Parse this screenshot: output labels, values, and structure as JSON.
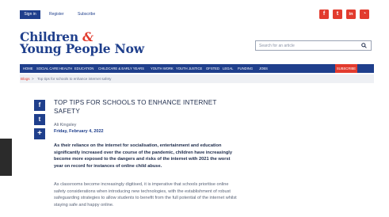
{
  "header": {
    "signin_label": "Sign in",
    "register_label": "Register",
    "subscribe_label": "Subscribe",
    "social": [
      {
        "icon": "facebook-icon",
        "glyph": "f"
      },
      {
        "icon": "twitter-icon",
        "glyph": "t"
      },
      {
        "icon": "linkedin-icon",
        "glyph": "in"
      },
      {
        "icon": "rss-icon",
        "glyph": "◔"
      }
    ],
    "social_color": "#e23b2e"
  },
  "logo": {
    "line1": "Children",
    "amp": "&",
    "line2": "Young People Now"
  },
  "search": {
    "placeholder": "Search for an article"
  },
  "nav": {
    "items": [
      "HOME",
      "SOCIAL CARE",
      "HEALTH",
      "EDUCATION",
      "CHILDCARE & EARLY YEARS",
      "YOUTH WORK",
      "YOUTH JUSTICE",
      "OFSTED",
      "LEGAL",
      "FUNDING",
      "JOBS"
    ],
    "subscribe_label": "SUBSCRIBE",
    "brand_color": "#1f3f8c",
    "accent_color": "#e23b2e"
  },
  "breadcrumb": {
    "blogs": "Blogs",
    "separator": ">",
    "current": "Top tips for schools to enhance internet safety"
  },
  "share": [
    {
      "icon": "facebook-icon",
      "glyph": "f"
    },
    {
      "icon": "twitter-icon",
      "glyph": "t"
    },
    {
      "icon": "plus-icon",
      "glyph": "+"
    }
  ],
  "article": {
    "title_line1": "TOP TIPS FOR SCHOOLS TO ENHANCE INTERNET",
    "title_line2": "SAFETY",
    "author": "Ali Kingsley",
    "date": "Friday, February 4, 2022",
    "lead": "As their reliance on the internet for socialisation, entertainment and education significantly increased over the course of the pandemic, children have increasingly become more exposed to the dangers and risks of the internet with 2021 the worst year on record for instances of online child abuse.",
    "paragraph": "As classrooms become increasingly digitised, it is imperative that schools prioritise online safety considerations when introducing new technologies, with the establishment of robust safeguarding strategies to allow students to benefit from the full potential of the internet whilst staying safe and happy online."
  }
}
